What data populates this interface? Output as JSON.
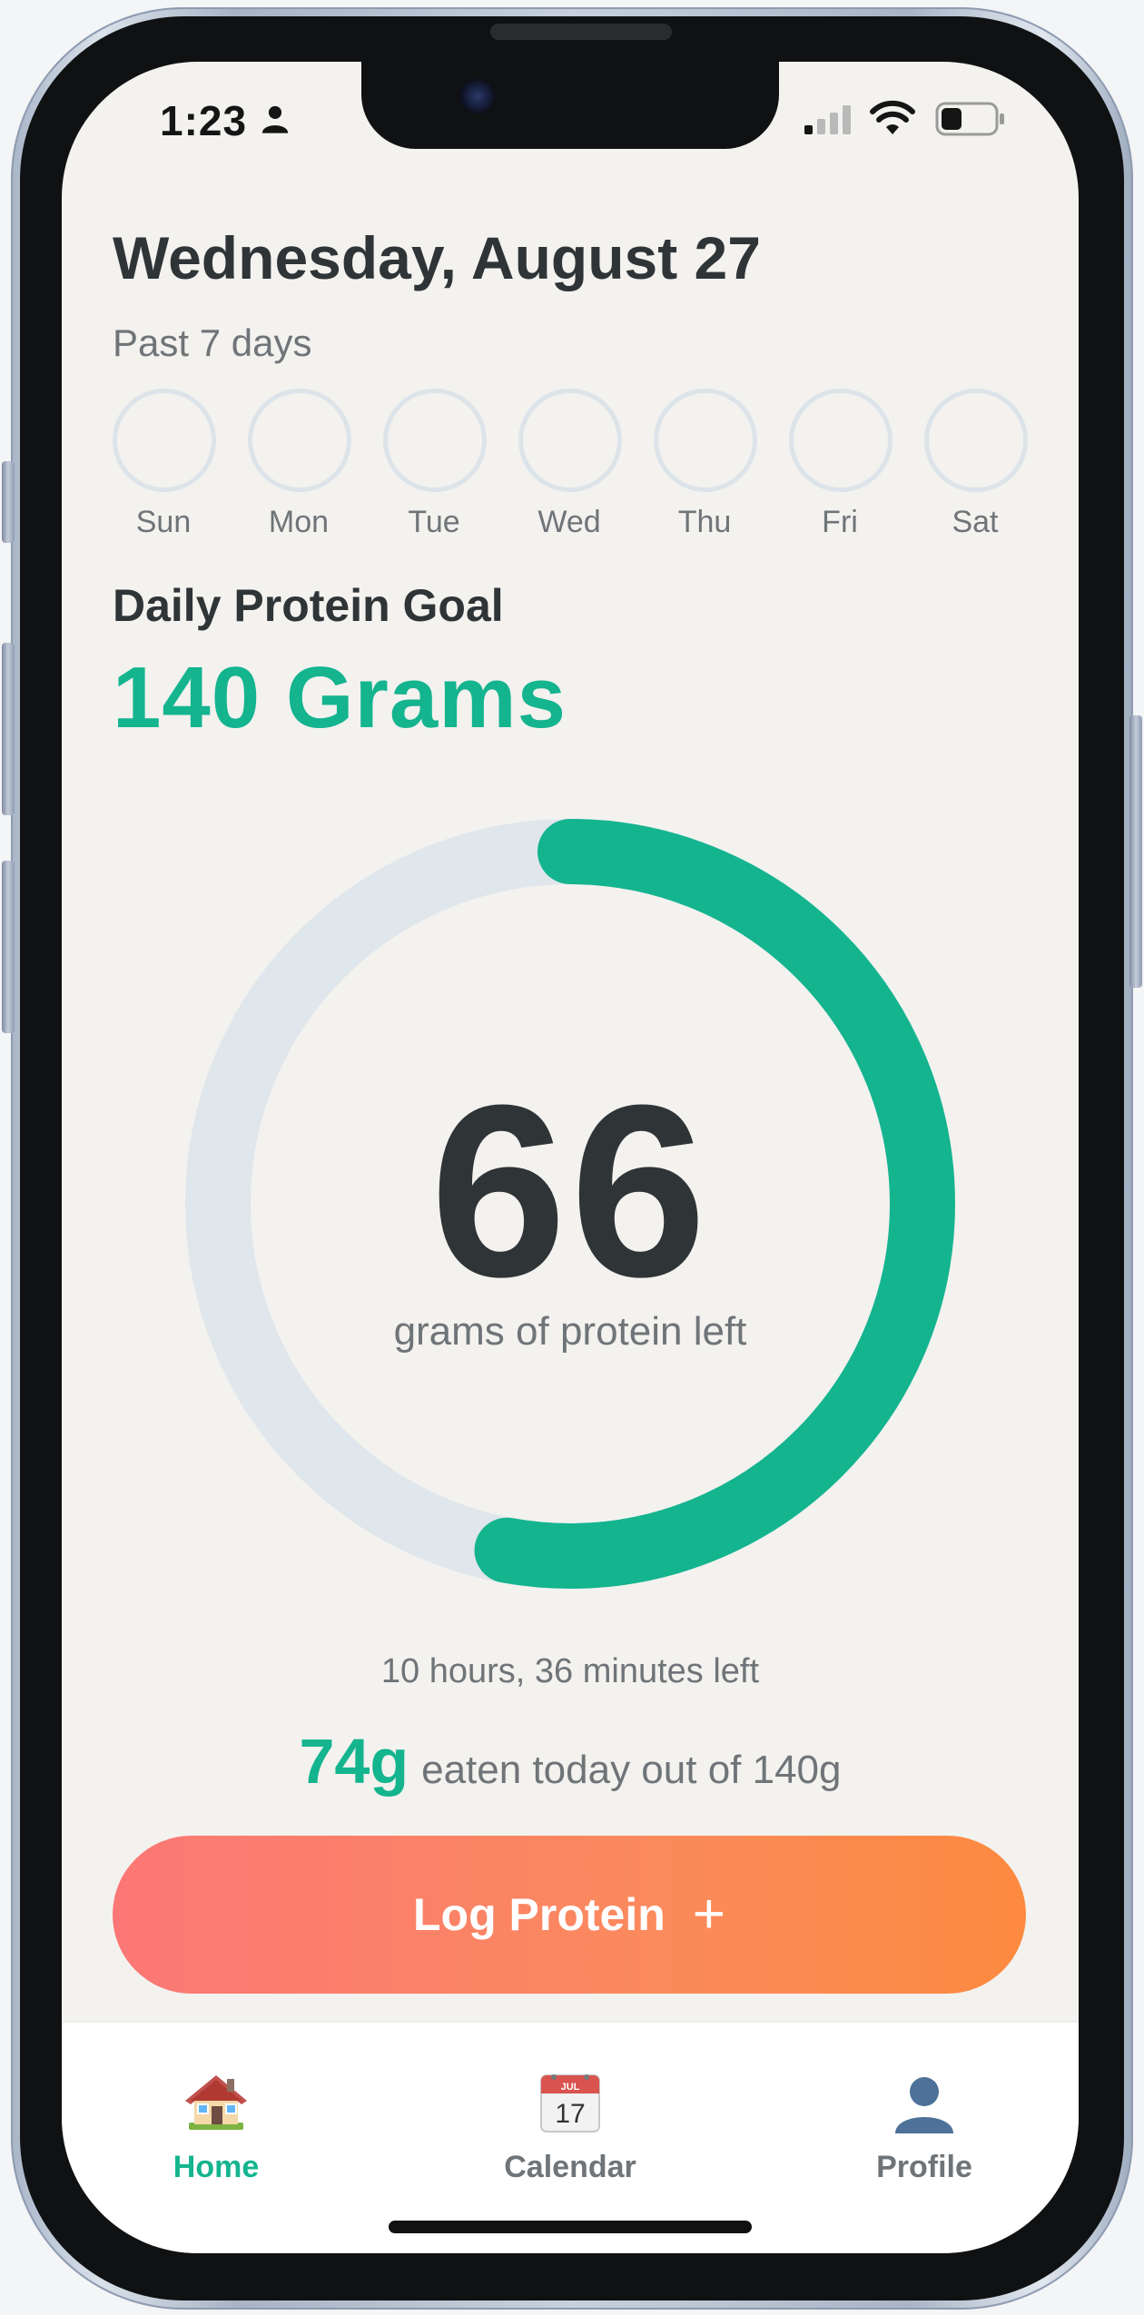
{
  "status_bar": {
    "time": "1:23",
    "icons": [
      "person-icon",
      "signal-icon",
      "wifi-icon",
      "battery-icon"
    ]
  },
  "header": {
    "date": "Wednesday, August 27",
    "range_label": "Past 7 days"
  },
  "week": {
    "days": [
      "Sun",
      "Mon",
      "Tue",
      "Wed",
      "Thu",
      "Fri",
      "Sat"
    ]
  },
  "goal": {
    "label": "Daily Protein Goal",
    "value": "140 Grams"
  },
  "progress": {
    "remaining": "66",
    "caption": "grams of protein left",
    "eaten_grams": 74,
    "goal_grams": 140,
    "fraction_eaten": 0.5286,
    "colors": {
      "progress": "#14b48f",
      "track": "#dfe6ec"
    }
  },
  "summary": {
    "time_left": "10 hours, 36 minutes left",
    "eaten_amount": "74g",
    "eaten_text": "eaten today out of 140g"
  },
  "log_button": {
    "label": "Log Protein",
    "icon": "plus-icon",
    "gradient": [
      "#fb7776",
      "#fd8a3f"
    ]
  },
  "tab_bar": {
    "tabs": [
      {
        "label": "Home",
        "icon": "house-icon",
        "active": true
      },
      {
        "label": "Calendar",
        "icon": "calendar-icon",
        "date_number": "17",
        "month_text": "JUL",
        "active": false
      },
      {
        "label": "Profile",
        "icon": "profile-icon",
        "active": false
      }
    ],
    "active_color": "#14b48f"
  }
}
